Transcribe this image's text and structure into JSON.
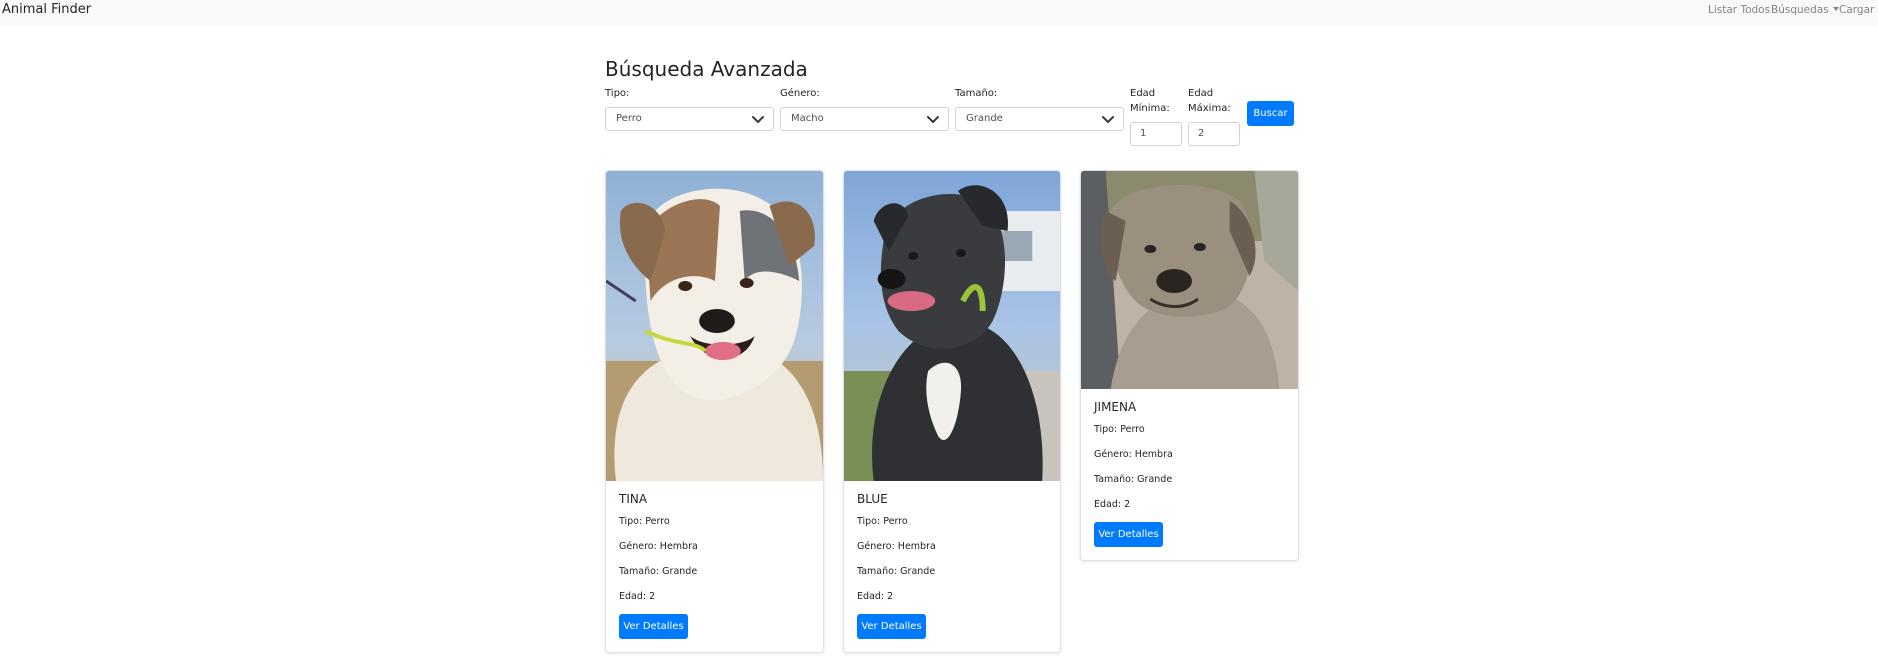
{
  "navbar": {
    "brand": "Animal Finder",
    "items": [
      {
        "label": "Listar Todos"
      },
      {
        "label": "Búsquedas"
      },
      {
        "label": "Cargar D"
      }
    ]
  },
  "search": {
    "title": "Búsqueda Avanzada",
    "fields": {
      "tipo": {
        "label": "Tipo:",
        "value": "Perro"
      },
      "genero": {
        "label": "Género:",
        "value": "Macho"
      },
      "tamano": {
        "label": "Tamaño:",
        "value": "Grande"
      },
      "edad_min": {
        "label_line1": "Edad",
        "label_line2": "Mínima:",
        "value": "1"
      },
      "edad_max": {
        "label_line1": "Edad",
        "label_line2": "Máxima:",
        "value": "2"
      }
    },
    "button_label": "Buscar"
  },
  "results": [
    {
      "name": "TINA",
      "tipo": "Tipo: Perro",
      "genero": "Género: Hembra",
      "tamano": "Tamaño: Grande",
      "edad": "Edad: 2",
      "button_label": "Ver Detalles"
    },
    {
      "name": "BLUE",
      "tipo": "Tipo: Perro",
      "genero": "Género: Hembra",
      "tamano": "Tamaño: Grande",
      "edad": "Edad: 2",
      "button_label": "Ver Detalles"
    },
    {
      "name": "JIMENA",
      "tipo": "Tipo: Perro",
      "genero": "Género: Hembra",
      "tamano": "Tamaño: Grande",
      "edad": "Edad: 2",
      "button_label": "Ver Detalles"
    }
  ],
  "colors": {
    "primary": "#007bff",
    "navbar_bg": "#f8f9fa",
    "nav_text": "#7f8588",
    "text": "#212529",
    "border": "#ced4da"
  }
}
